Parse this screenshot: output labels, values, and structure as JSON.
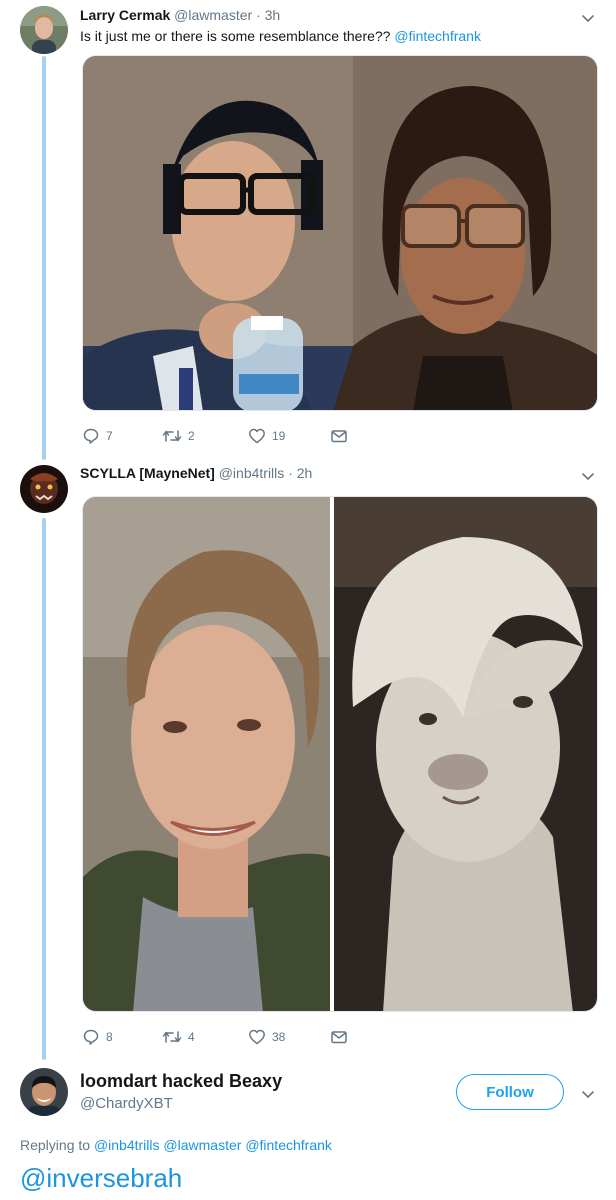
{
  "tweets": [
    {
      "name": "Larry Cermak",
      "handle": "@lawmaster",
      "time": "3h",
      "text_prefix": "Is it just me or there is some resemblance there?? ",
      "text_mention": "@fintechfrank",
      "replies": "7",
      "retweets": "2",
      "likes": "19"
    },
    {
      "name": "SCYLLA [MayneNet]",
      "handle": "@inb4trills",
      "time": "2h",
      "replies": "8",
      "retweets": "4",
      "likes": "38"
    }
  ],
  "focus_tweet": {
    "name": "loomdart hacked Beaxy",
    "handle": "@ChardyXBT",
    "follow_label": "Follow",
    "replying_label": "Replying to",
    "replying_mentions": [
      "@inb4trills",
      "@lawmaster",
      "@fintechfrank"
    ],
    "text": "@inversebrah"
  },
  "icons": {
    "reply": "reply-icon",
    "retweet": "retweet-icon",
    "like": "heart-icon",
    "dm": "envelope-icon",
    "menu": "chevron-down-icon"
  },
  "colors": {
    "accent": "#1da1f2",
    "link": "#1b95e0",
    "muted": "#657786",
    "thread": "#a6d2f2"
  }
}
